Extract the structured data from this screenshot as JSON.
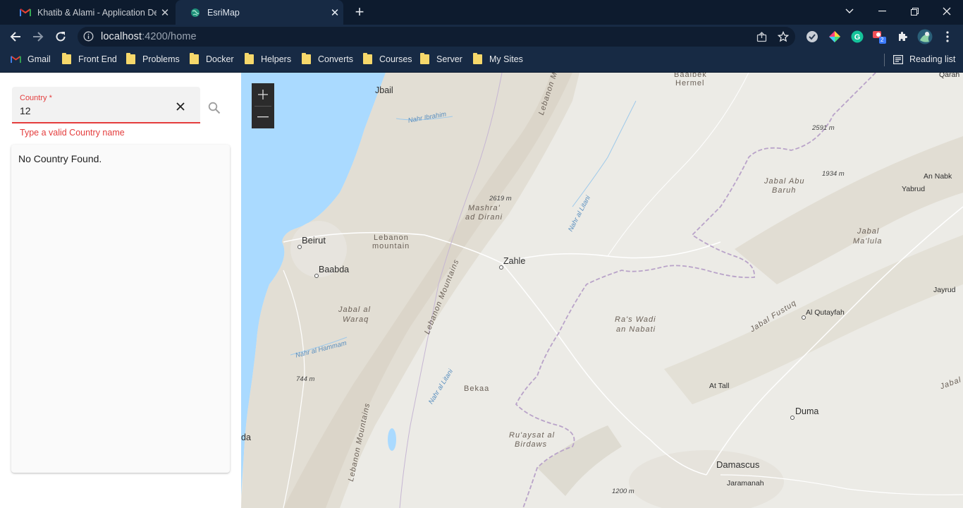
{
  "browser": {
    "tabs": [
      {
        "title": "Khatib & Alami - Application Dev",
        "favicon": "gmail-icon",
        "active": false
      },
      {
        "title": "EsriMap",
        "favicon": "globe-icon",
        "active": true
      }
    ],
    "url_host": "localhost",
    "url_path": ":4200/home",
    "bookmarks": [
      {
        "label": "Gmail",
        "icon": "gmail-icon"
      },
      {
        "label": "Front End",
        "icon": "folder-icon"
      },
      {
        "label": "Problems",
        "icon": "folder-icon"
      },
      {
        "label": "Docker",
        "icon": "folder-icon"
      },
      {
        "label": "Helpers",
        "icon": "folder-icon"
      },
      {
        "label": "Converts",
        "icon": "folder-icon"
      },
      {
        "label": "Courses",
        "icon": "folder-icon"
      },
      {
        "label": "Server",
        "icon": "folder-icon"
      },
      {
        "label": "My Sites",
        "icon": "folder-icon"
      }
    ],
    "reading_list": "Reading list",
    "extension_badge": "2"
  },
  "search": {
    "label": "Country *",
    "value": "12",
    "error": "Type a valid Country name"
  },
  "results": {
    "empty_text": "No Country Found."
  },
  "map": {
    "zoom_in": "+",
    "zoom_out": "—",
    "places": {
      "jbail": "Jbail",
      "baalbek": "Baalbek",
      "hermel": "Hermel",
      "qarah": "Qarah",
      "beirut": "Beirut",
      "baabda": "Baabda",
      "zahle": "Zahle",
      "yabrud": "Yabrud",
      "an_nabk": "An Nabk",
      "jayrud": "Jayrud",
      "al_qutayfah": "Al Qutayfah",
      "at_tall": "At Tall",
      "duma": "Duma",
      "damascus": "Damascus",
      "jaramanah": "Jaramanah",
      "bekaa": "Bekaa",
      "da": "da"
    },
    "features": {
      "lebanon_mountains_n": "Lebanon Mountains",
      "lebanon_mountains_c": "Lebanon Mountains",
      "lebanon_mountains_s": "Lebanon Mountains",
      "mashra_1": "Mashra'",
      "mashra_2": "ad Dirani",
      "lebanon_mtn_1": "Lebanon",
      "lebanon_mtn_2": "mountain",
      "jabal_abu_1": "Jabal Abu",
      "jabal_abu_2": "Baruh",
      "jabal_malula_1": "Jabal",
      "jabal_malula_2": "Ma'lula",
      "jabal_fustuq": "Jabal Fustuq",
      "jabal_al_waraq_1": "Jabal al",
      "jabal_al_waraq_2": "Waraq",
      "ras_wadi_1": "Ra's Wadi",
      "ras_wadi_2": "an Nabati",
      "ruaysat_1": "Ru'aysat al",
      "ruaysat_2": "Birdaws",
      "jabal_right": "Jabal"
    },
    "rivers": {
      "ibrahim": "Nahr Ibrahim",
      "litani_1": "Nahr al Litani",
      "hammam": "Nahr al Hammam",
      "litani_2": "Nahr al Litani"
    },
    "elevations": {
      "e2591": "2591 m",
      "e1934": "1934 m",
      "e2619": "2619 m",
      "e744": "744 m",
      "e1200": "1200 m"
    },
    "colors": {
      "sea": "#aadaff",
      "land": "#ecebe6",
      "border": "#b9a3c9"
    }
  }
}
